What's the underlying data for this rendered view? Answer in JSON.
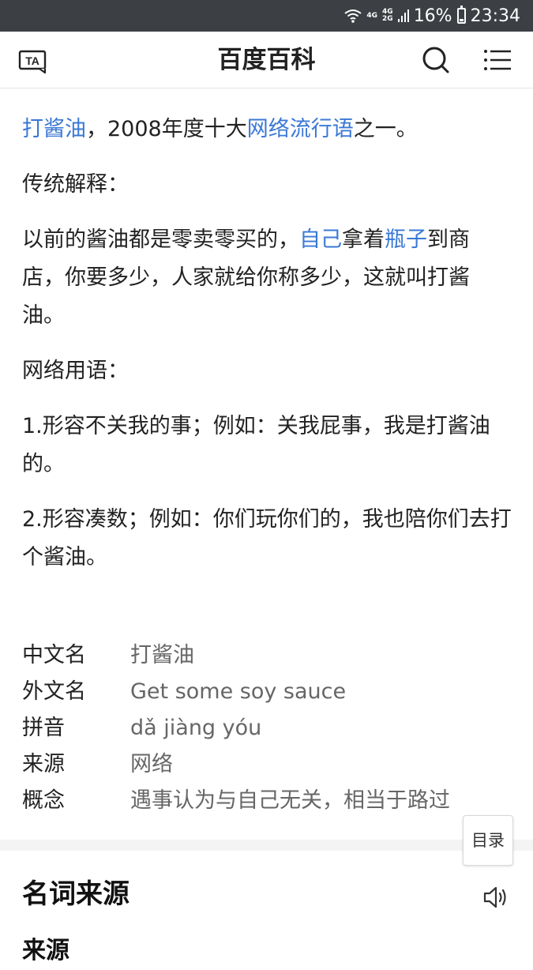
{
  "status": {
    "net_top": "4G",
    "net_mid": "4G",
    "net_bottom": "2G",
    "battery": "16%",
    "time": "23:34"
  },
  "header": {
    "title": "百度百科"
  },
  "intro": {
    "term": "打酱油",
    "text1": "，2008年度十大",
    "link": "网络流行语",
    "text2": "之一。"
  },
  "traditional": {
    "heading": "传统解释：",
    "text1": "以前的酱油都是零卖零买的，",
    "link1": "自己",
    "text2": "拿着",
    "link2": "瓶子",
    "text3": "到商店，你要多少，人家就给你称多少，这就叫打酱油。"
  },
  "internet": {
    "heading": "网络用语：",
    "item1": "1.形容不关我的事；例如：关我屁事，我是打酱油的。",
    "item2": "2.形容凑数；例如：你们玩你们的，我也陪你们去打个酱油。"
  },
  "infobox": [
    {
      "key": "中文名",
      "value": "打酱油"
    },
    {
      "key": "外文名",
      "value": "Get some soy sauce"
    },
    {
      "key": "拼音",
      "value": "dǎ jiàng yóu"
    },
    {
      "key": "来源",
      "value": "网络"
    },
    {
      "key": "概念",
      "value": "遇事认为与自己无关，相当于路过"
    }
  ],
  "toc_label": "目录",
  "section": {
    "title": "名词来源",
    "subtitle": "来源"
  }
}
